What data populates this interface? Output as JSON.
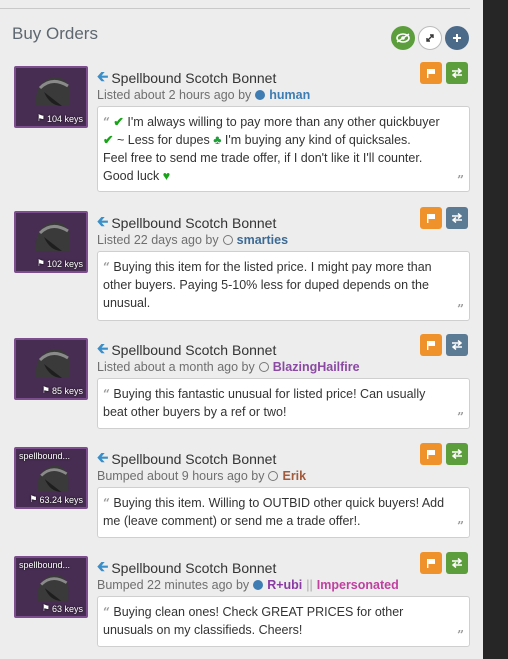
{
  "header": {
    "title": "Buy Orders",
    "buttons": [
      {
        "icon": "eye-icon",
        "color": "#5c9e3c"
      },
      {
        "icon": "expand-icon",
        "color": "#ffffff"
      },
      {
        "icon": "plus-icon",
        "color": "#4b6a8a"
      }
    ]
  },
  "listings": [
    {
      "item": "Spellbound Scotch Bonnet",
      "price": "104 keys",
      "thumb_label": "",
      "time": "Listed about 2 hours ago by",
      "user": "human",
      "user_color": "#3d7db3",
      "dot_style": "filled-blue",
      "extra": "",
      "trade_color": "#5c9e3c",
      "comment": {
        "line1": "I'm always willing to pay more than any other quickbuyer",
        "line2a": "~ Less for dupes",
        "line2b": "I'm buying any kind of quicksales.",
        "line3": "Feel free to send me trade offer, if I don't like it I'll counter.",
        "line4": "Good luck"
      }
    },
    {
      "item": "Spellbound Scotch Bonnet",
      "price": "102 keys",
      "thumb_label": "",
      "time": "Listed 22 days ago by",
      "user": "smarties",
      "user_color": "#3d6a94",
      "dot_style": "hollow",
      "extra": "",
      "trade_color": "#5b7a93",
      "comment": "Buying this item for the listed price. I might pay more than other buyers. Paying 5-10% less for duped depends on the unusual."
    },
    {
      "item": "Spellbound Scotch Bonnet",
      "price": "85 keys",
      "thumb_label": "",
      "time": "Listed about a month ago by",
      "user": "BlazingHailfire",
      "user_color": "#8a4aa3",
      "dot_style": "hollow",
      "extra": "",
      "trade_color": "#5b7a93",
      "comment": "Buying this fantastic unusual for listed price! Can usually beat other buyers by a ref or two!"
    },
    {
      "item": "Spellbound Scotch Bonnet",
      "price": "63.24 keys",
      "thumb_label": "spellbound...",
      "time": "Bumped about 9 hours ago by",
      "user": "Erik",
      "user_color": "#a25a3a",
      "dot_style": "hollow",
      "extra": "",
      "trade_color": "#5c9e3c",
      "comment": "Buying this item. Willing to OUTBID other quick buyers! Add me (leave comment) or send me a trade offer!."
    },
    {
      "item": "Spellbound Scotch Bonnet",
      "price": "63 keys",
      "thumb_label": "spellbound...",
      "time": "Bumped 22 minutes ago by",
      "user": "R+ubi",
      "user_color": "#8a3aa3",
      "dot_style": "filled-blue",
      "extra": "Impersonated",
      "extra_color": "#c040a0",
      "trade_color": "#5c9e3c",
      "comment": "Buying clean ones! Check GREAT PRICES for other unusuals on my classifieds. Cheers!"
    }
  ]
}
